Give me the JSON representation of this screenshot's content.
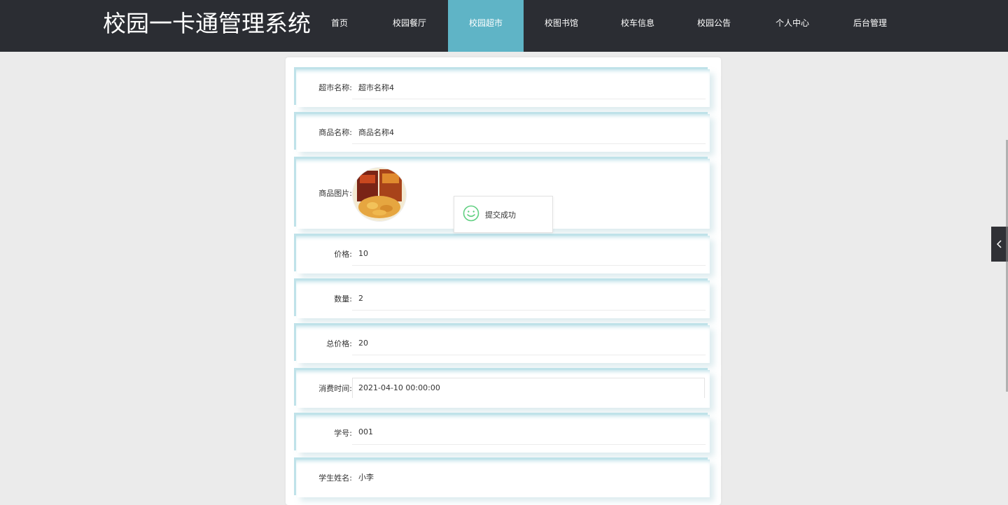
{
  "app": {
    "title": "校园一卡通管理系统"
  },
  "nav": {
    "items": [
      {
        "label": "首页"
      },
      {
        "label": "校园餐厅"
      },
      {
        "label": "校园超市"
      },
      {
        "label": "校图书馆"
      },
      {
        "label": "校车信息"
      },
      {
        "label": "校园公告"
      },
      {
        "label": "个人中心"
      },
      {
        "label": "后台管理"
      }
    ],
    "active_index": 2
  },
  "form": {
    "rows": [
      {
        "label": "超市名称:",
        "value": "超市名称4"
      },
      {
        "label": "商品名称:",
        "value": "商品名称4"
      },
      {
        "label": "商品图片:",
        "value": ""
      },
      {
        "label": "价格:",
        "value": "10"
      },
      {
        "label": "数量:",
        "value": "2"
      },
      {
        "label": "总价格:",
        "value": "20"
      },
      {
        "label": "消费时间:",
        "value": "2021-04-10 00:00:00"
      },
      {
        "label": "学号:",
        "value": "001"
      },
      {
        "label": "学生姓名:",
        "value": "小李"
      }
    ]
  },
  "toast": {
    "message": "提交成功",
    "icon": "smile-icon"
  },
  "side_tab": {
    "icon": "chevron-left-icon"
  },
  "colors": {
    "nav_bg": "#2b2d33",
    "nav_active": "#5fb4c6",
    "row_accent": "#bfe2e9",
    "toast_icon": "#5fcf80"
  }
}
